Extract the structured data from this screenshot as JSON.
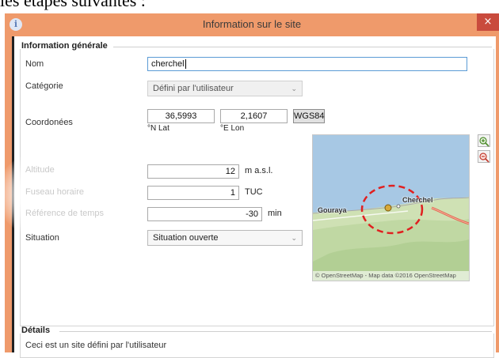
{
  "document": {
    "text": "les étapes suivantes :"
  },
  "window": {
    "title": "Information sur le site",
    "icon": "info-icon",
    "close_glyph": "×"
  },
  "general": {
    "heading": "Information générale",
    "name_label": "Nom",
    "name_value": "cherchel",
    "category_label": "Catégorie",
    "category_value": "Défini par l'utilisateur",
    "coords_label": "Coordonées",
    "lat_value": "36,5993",
    "lat_unit": "°N Lat",
    "lon_value": "2,1607",
    "lon_unit": "°E Lon",
    "datum_button": "WGS84",
    "altitude_label": "Altitude",
    "altitude_value": "12",
    "altitude_unit": "m a.s.l.",
    "timezone_label": "Fuseau horaire",
    "timezone_value": "1",
    "timezone_unit": "TUC",
    "timeref_label": "Référence de temps",
    "timeref_value": "-30",
    "timeref_unit": "min",
    "situation_label": "Situation",
    "situation_value": "Situation ouverte"
  },
  "map": {
    "labels": {
      "city": "Cherchel",
      "town": "Gouraya"
    },
    "attribution": "© OpenStreetMap - Map data ©2016 OpenStreetMap",
    "zoom_in_icon": "zoom-in-icon",
    "zoom_out_icon": "zoom-out-icon",
    "annotation": "red-dashed-circle",
    "colors": {
      "sea": "#a7c8e4",
      "land": "#cfe1b4",
      "road": "#e2674c",
      "highlight": "#e02020"
    }
  },
  "details": {
    "heading": "Détails",
    "text": "Ceci est un site défini par l'utilisateur"
  },
  "colors": {
    "titlebar": "#ef9a6b",
    "close": "#c94b3d",
    "focus_border": "#5b9bd5"
  }
}
